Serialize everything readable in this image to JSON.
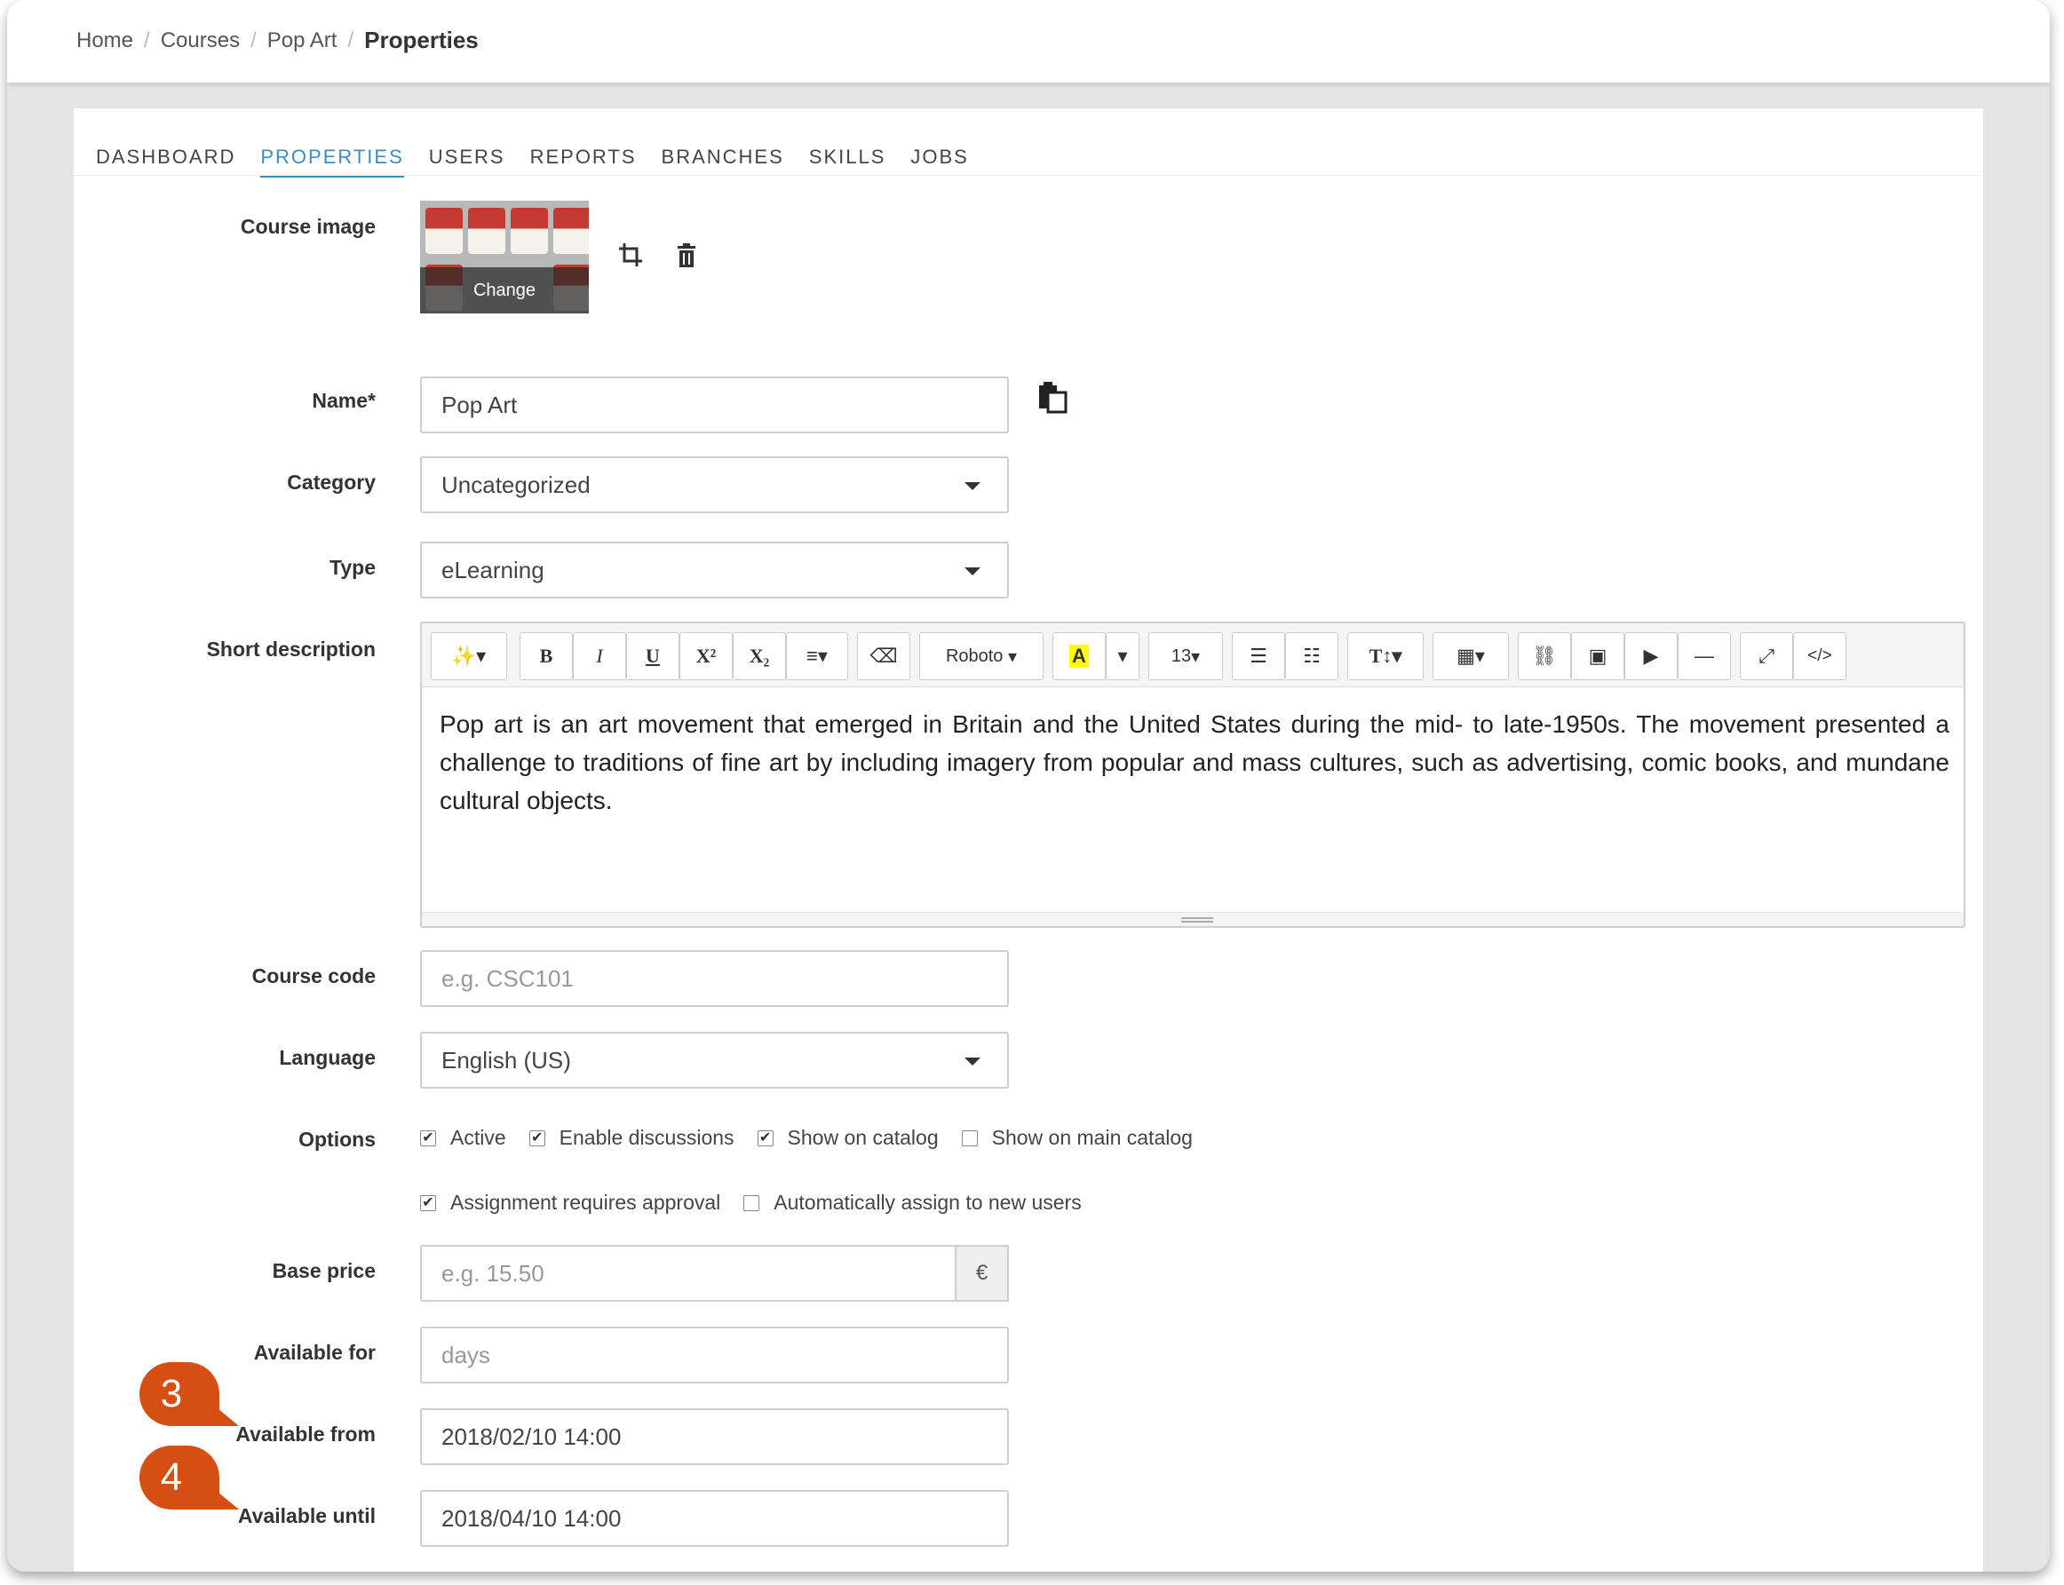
{
  "breadcrumb": {
    "home": "Home",
    "courses": "Courses",
    "course": "Pop Art",
    "current": "Properties",
    "separator": "/"
  },
  "tabs": [
    "DASHBOARD",
    "PROPERTIES",
    "USERS",
    "REPORTS",
    "BRANCHES",
    "SKILLS",
    "JOBS"
  ],
  "active_tab": "PROPERTIES",
  "accent_color": "#3c8dbc",
  "marker_color": "#d64f12",
  "form": {
    "course_image": {
      "label": "Course image",
      "change_label": "Change",
      "crop_icon": "crop-icon",
      "delete_icon": "trash-icon"
    },
    "name": {
      "label": "Name*",
      "value": "Pop Art",
      "copy_icon": "clipboard-icon"
    },
    "category": {
      "label": "Category",
      "value": "Uncategorized"
    },
    "type": {
      "label": "Type",
      "value": "eLearning"
    },
    "short_description": {
      "label": "Short description",
      "toolbar": {
        "font": "Roboto",
        "size": "13"
      },
      "text": "Pop art is an art movement that emerged in Britain and the United States during the mid- to late-1950s. The movement presented a challenge to traditions of fine art by including imagery from popular and mass cultures, such as advertising, comic books, and mundane cultural objects."
    },
    "course_code": {
      "label": "Course code",
      "placeholder": "e.g. CSC101"
    },
    "language": {
      "label": "Language",
      "value": "English (US)"
    },
    "options": {
      "label": "Options",
      "active": {
        "label": "Active",
        "checked": true
      },
      "enable_discussions": {
        "label": "Enable discussions",
        "checked": true
      },
      "show_on_catalog": {
        "label": "Show on catalog",
        "checked": true
      },
      "show_on_main_catalog": {
        "label": "Show on main catalog",
        "checked": false
      },
      "assignment_requires_approval": {
        "label": "Assignment requires approval",
        "checked": true
      },
      "auto_assign_new_users": {
        "label": "Automatically assign to new users",
        "checked": false
      }
    },
    "base_price": {
      "label": "Base price",
      "placeholder": "e.g. 15.50",
      "currency": "€"
    },
    "available_for": {
      "label": "Available for",
      "placeholder": "days"
    },
    "available_from": {
      "label": "Available from",
      "value": "2018/02/10 14:00",
      "marker": "3"
    },
    "available_until": {
      "label": "Available until",
      "value": "2018/04/10 14:00",
      "marker": "4"
    }
  }
}
